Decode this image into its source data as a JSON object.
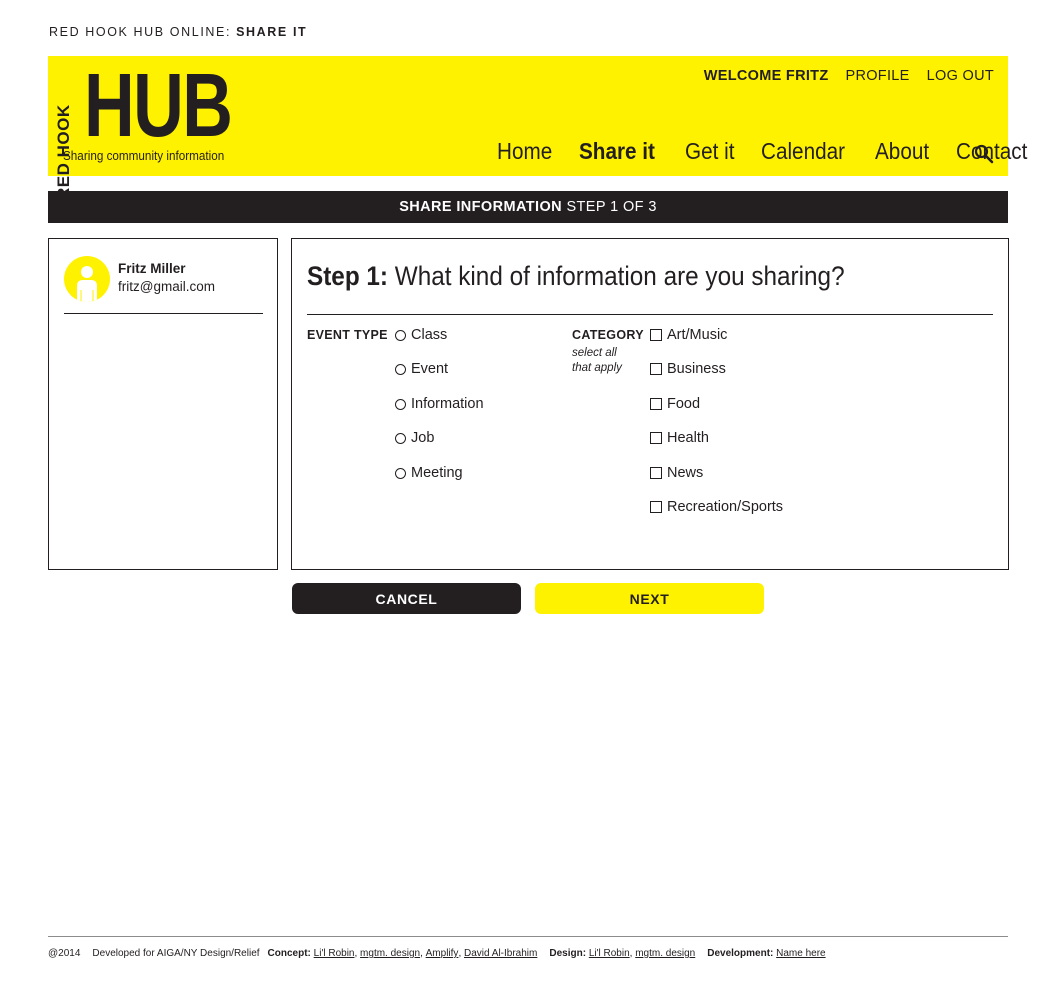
{
  "page_title": {
    "prefix": "RED HOOK HUB ONLINE:",
    "section": "SHARE IT"
  },
  "header": {
    "logo_small": "RED HOOK",
    "logo_big": "HUB",
    "tagline": "Sharing community information",
    "account": {
      "welcome": "WELCOME FRITZ",
      "profile": "PROFILE",
      "logout": "LOG OUT"
    },
    "nav": [
      {
        "label": "Home"
      },
      {
        "label": "Share it"
      },
      {
        "label": "Get it"
      },
      {
        "label": "Calendar"
      },
      {
        "label": "About"
      },
      {
        "label": "Contact"
      }
    ],
    "search_icon": "search-icon"
  },
  "step_bar": {
    "title": "SHARE INFORMATION",
    "step": "STEP 1 OF 3"
  },
  "profile": {
    "name": "Fritz Miller",
    "email": "fritz@gmail.com"
  },
  "form": {
    "step_label": "Step 1:",
    "question": "What kind of information are you sharing?",
    "event_type": {
      "label": "EVENT TYPE",
      "options": [
        "Class",
        "Event",
        "Information",
        "Job",
        "Meeting"
      ]
    },
    "category": {
      "label": "CATEGORY",
      "hint_line1": "select all",
      "hint_line2": "that apply",
      "options": [
        "Art/Music",
        "Business",
        "Food",
        "Health",
        "News",
        "Recreation/Sports"
      ]
    }
  },
  "buttons": {
    "cancel": "CANCEL",
    "next": "NEXT"
  },
  "footer": {
    "copyright": "@2014",
    "developed_for": "Developed for AIGA/NY Design/Relief",
    "concept_label": "Concept:",
    "concept_names": [
      "Li'l Robin",
      "mgtm. design",
      "Amplify",
      "David Al-Ibrahim"
    ],
    "design_label": "Design:",
    "design_names": [
      "Li'l Robin",
      "mgtm. design"
    ],
    "development_label": "Development:",
    "development_name": "Name here"
  },
  "colors": {
    "accent": "#fff200",
    "dark": "#231f20"
  }
}
